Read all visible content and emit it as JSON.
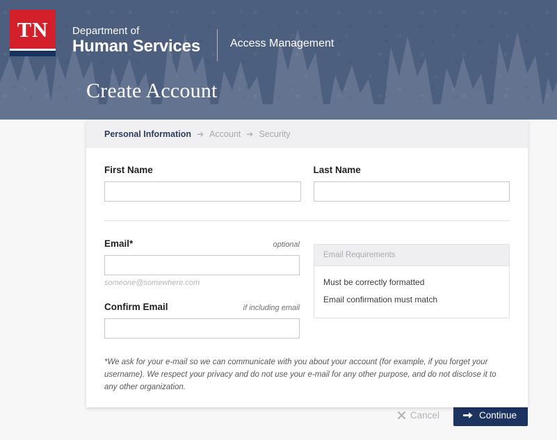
{
  "header": {
    "logo_text": "TN",
    "department_line1": "Department of",
    "department_line2": "Human Services",
    "app_name": "Access Management"
  },
  "page": {
    "title": "Create Account"
  },
  "breadcrumb": {
    "steps": [
      {
        "label": "Personal Information",
        "state": "active"
      },
      {
        "label": "Account",
        "state": "inactive"
      },
      {
        "label": "Security",
        "state": "inactive"
      }
    ],
    "separator": "➔"
  },
  "form": {
    "first_name": {
      "label": "First Name",
      "value": "",
      "placeholder": ""
    },
    "last_name": {
      "label": "Last Name",
      "value": "",
      "placeholder": ""
    },
    "email": {
      "label": "Email*",
      "hint": "optional",
      "value": "",
      "placeholder": "",
      "note": "someone@somewhere.com"
    },
    "confirm_email": {
      "label": "Confirm Email",
      "hint": "if including email",
      "value": "",
      "placeholder": ""
    },
    "disclaimer": "*We ask for your e-mail so we can communicate with you about your account (for example, if you forget your username). We respect your privacy and do not use your e-mail for any other purpose, and do not disclose it to any other organization."
  },
  "requirements": {
    "title": "Email Requirements",
    "items": [
      "Must be correctly formatted",
      "Email confirmation must match"
    ]
  },
  "actions": {
    "cancel_label": "Cancel",
    "continue_label": "Continue"
  },
  "colors": {
    "hero": "#4d5f7f",
    "brand_red": "#d3202a",
    "brand_navy": "#17325f",
    "primary_button": "#1d3461",
    "page_background": "#f7f7f8",
    "card_header": "#f0f0f2"
  }
}
